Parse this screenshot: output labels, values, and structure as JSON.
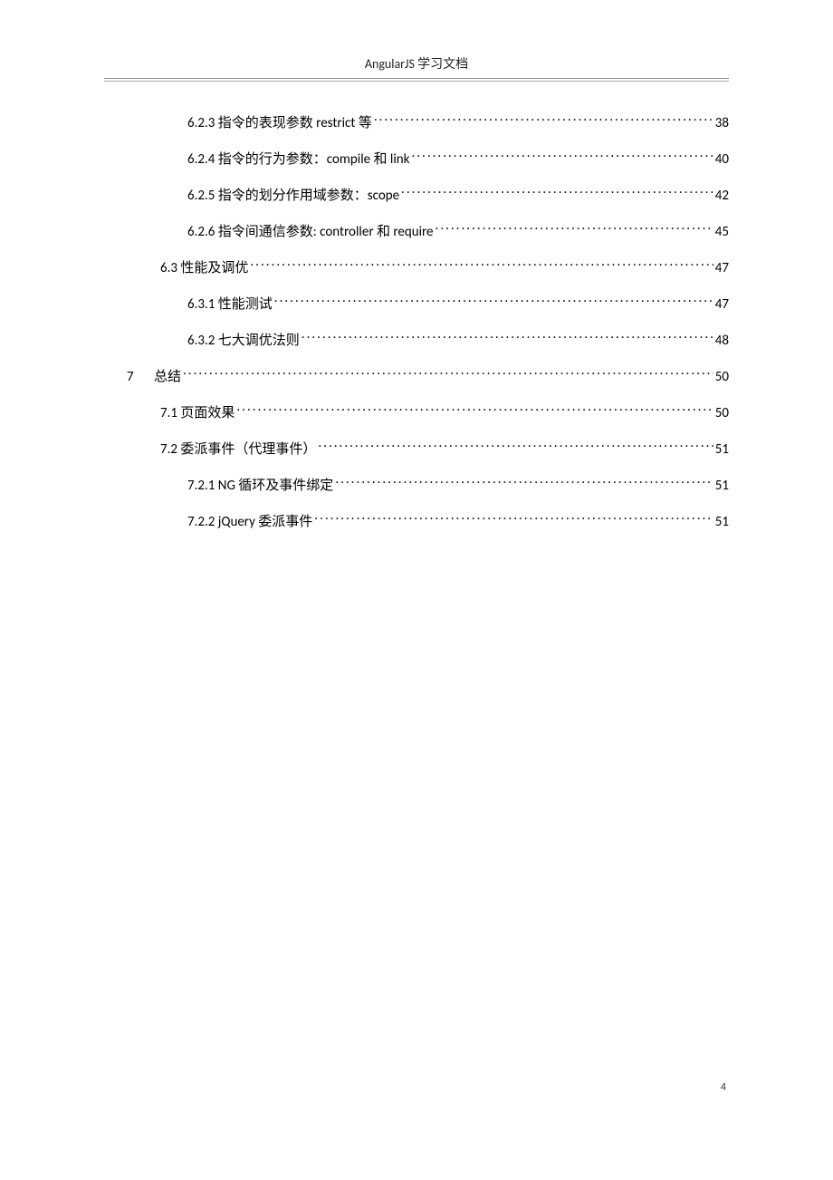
{
  "header": {
    "title": "AngularJS 学习文档"
  },
  "toc": {
    "entries": [
      {
        "level": 3,
        "chapnum": "",
        "label": "6.2.3 指令的表现参数 restrict 等",
        "page": "38"
      },
      {
        "level": 3,
        "chapnum": "",
        "label": "6.2.4 指令的行为参数：compile 和 link",
        "page": "40"
      },
      {
        "level": 3,
        "chapnum": "",
        "label": "6.2.5 指令的划分作用域参数：scope",
        "page": "42"
      },
      {
        "level": 3,
        "chapnum": "",
        "label": "6.2.6 指令间通信参数: controller 和 require",
        "page": "45"
      },
      {
        "level": 2,
        "chapnum": "",
        "label": "6.3  性能及调优",
        "page": "47"
      },
      {
        "level": 3,
        "chapnum": "",
        "label": "6.3.1 性能测试",
        "page": "47"
      },
      {
        "level": 3,
        "chapnum": "",
        "label": "6.3.2 七大调优法则",
        "page": "48"
      },
      {
        "level": 1,
        "chapnum": "7",
        "label": "总结",
        "page": "50"
      },
      {
        "level": 2,
        "chapnum": "",
        "label": "7.1 页面效果",
        "page": "50"
      },
      {
        "level": 2,
        "chapnum": "",
        "label": "7.2 委派事件（代理事件）",
        "page": "51"
      },
      {
        "level": 3,
        "chapnum": "",
        "label": "7.2.1 NG 循环及事件绑定",
        "page": "51"
      },
      {
        "level": 3,
        "chapnum": "",
        "label": "7.2.2 jQuery 委派事件",
        "page": "51"
      }
    ]
  },
  "footer": {
    "page_number": "4"
  }
}
